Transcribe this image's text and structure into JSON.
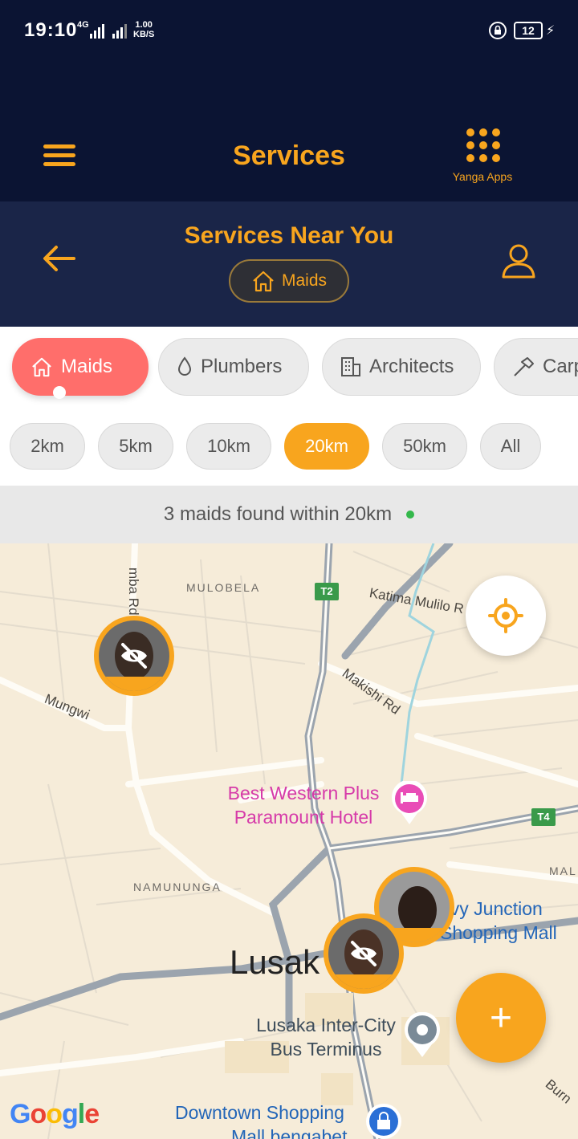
{
  "status_bar": {
    "time": "19:10",
    "network": "4G",
    "speed_value": "1.00",
    "speed_unit": "KB/S",
    "battery": "12"
  },
  "header": {
    "title": "Services",
    "apps_label": "Yanga Apps"
  },
  "sub_header": {
    "title": "Services Near You",
    "chip_label": "Maids"
  },
  "categories": [
    {
      "label": "Maids",
      "icon": "home-icon",
      "active": true
    },
    {
      "label": "Plumbers",
      "icon": "drop-icon",
      "active": false
    },
    {
      "label": "Architects",
      "icon": "building-icon",
      "active": false
    },
    {
      "label": "Carp",
      "icon": "hammer-icon",
      "active": false
    }
  ],
  "distances": [
    {
      "label": "2km",
      "active": false
    },
    {
      "label": "5km",
      "active": false
    },
    {
      "label": "10km",
      "active": false
    },
    {
      "label": "20km",
      "active": true
    },
    {
      "label": "50km",
      "active": false
    },
    {
      "label": "All",
      "active": false
    }
  ],
  "results": {
    "text": "3 maids found within 20km"
  },
  "map": {
    "labels": {
      "mulobela": "MULOBELA",
      "namununga": "NAMUNUNGA",
      "mal": "MAL",
      "katima": "Katima Mulilo R",
      "makishi": "Makishi Rd",
      "mungwi": "Mungwi",
      "mba": "mba Rd",
      "hotel_line1": "Best Western Plus",
      "hotel_line2": "Paramount Hotel",
      "junction_line1": "evy Junction",
      "junction_line2": "Shopping Mall",
      "city": "Lusak",
      "bus_line1": "Lusaka Inter-City",
      "bus_line2": "Bus Terminus",
      "downtown_line1": "Downtown Shopping",
      "downtown_line2": "Mall bengabet",
      "burn": "Burn",
      "t2": "T2",
      "t4": "T4"
    },
    "google": "Google",
    "fab_label": "+"
  },
  "colors": {
    "accent": "#f8a51e",
    "header_bg": "#0b1433",
    "subheader_bg": "#1a2548",
    "active_category": "#ff6e6b"
  }
}
